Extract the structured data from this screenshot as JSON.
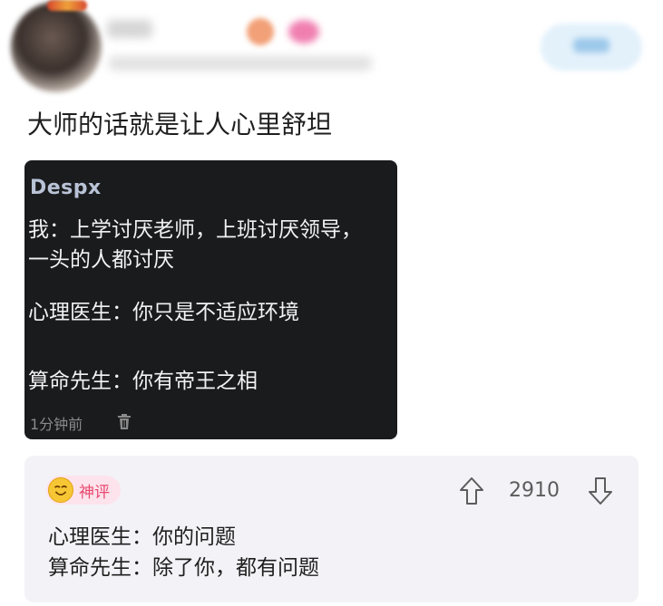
{
  "post": {
    "text": "大师的话就是让人心里舒坦"
  },
  "screenshot": {
    "author": "Despx",
    "lines": [
      "我：上学讨厌老师，上班讨厌领导，",
      "一头的人都讨厌",
      "心理医生：你只是不适应环境",
      "算命先生：你有帝王之相"
    ],
    "time": "1分钟前",
    "delete_icon": "trash-icon"
  },
  "comment": {
    "tag": "神评",
    "tag_icon": "smiley-face-icon",
    "votes": "2910",
    "lines": [
      "心理医生：你的问题",
      "算命先生：除了你，都有问题"
    ]
  },
  "colors": {
    "shot_background": "#1a1b1d",
    "tag_text": "#e8496f",
    "tag_background": "#fde3ec",
    "comment_background": "#f3f2f7"
  }
}
